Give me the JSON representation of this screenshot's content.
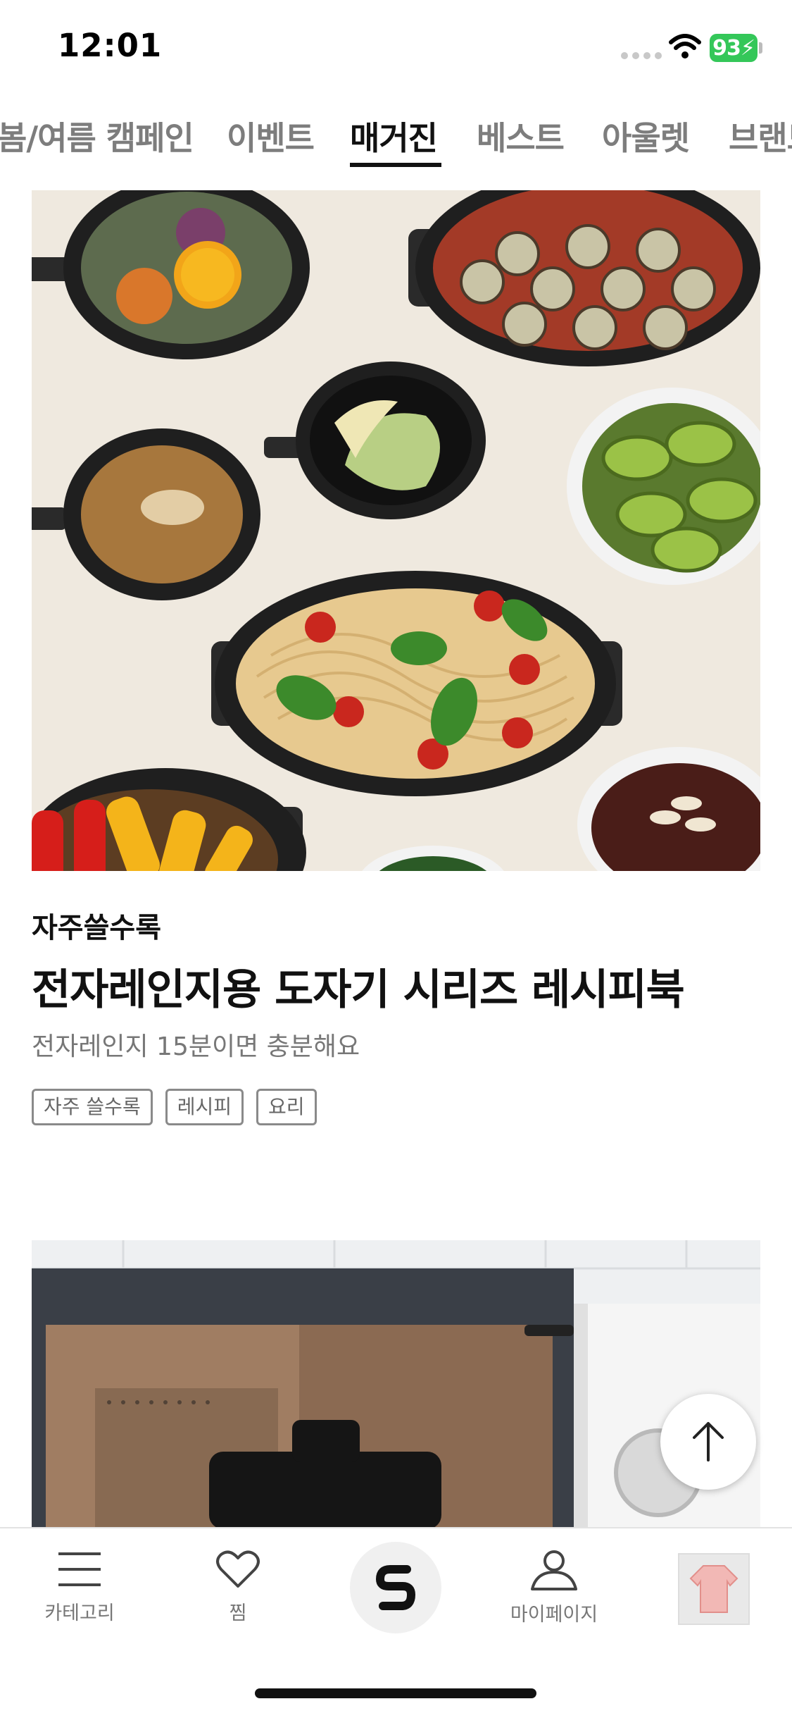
{
  "status_bar": {
    "time": "12:01",
    "battery": "93"
  },
  "tabs": [
    {
      "label": "봄/여름 캠페인",
      "active": false
    },
    {
      "label": "이벤트",
      "active": false
    },
    {
      "label": "매거진",
      "active": true
    },
    {
      "label": "베스트",
      "active": false
    },
    {
      "label": "아울렛",
      "active": false
    },
    {
      "label": "브랜드",
      "active": false
    }
  ],
  "article1": {
    "image_alt": "food-dishes-icon",
    "category": "자주쓸수록",
    "title": "전자레인지용 도자기 시리즈 레시피북",
    "subtitle": "전자레인지 15분이면 충분해요",
    "tags": [
      "자주 쓸수록",
      "레시피",
      "요리"
    ]
  },
  "article2": {
    "image_alt": "microwave-icon"
  },
  "bottom_nav": {
    "items": [
      {
        "label": "카테고리",
        "icon": "menu-icon"
      },
      {
        "label": "찜",
        "icon": "heart-icon"
      },
      {
        "label": "",
        "icon": "home-logo-icon"
      },
      {
        "label": "마이페이지",
        "icon": "person-icon"
      },
      {
        "label": "",
        "icon": "recent-item-thumbnail"
      }
    ]
  },
  "colors": {
    "accent": "#111111",
    "battery": "#34c759",
    "tab_inactive": "#7d7d7d"
  }
}
